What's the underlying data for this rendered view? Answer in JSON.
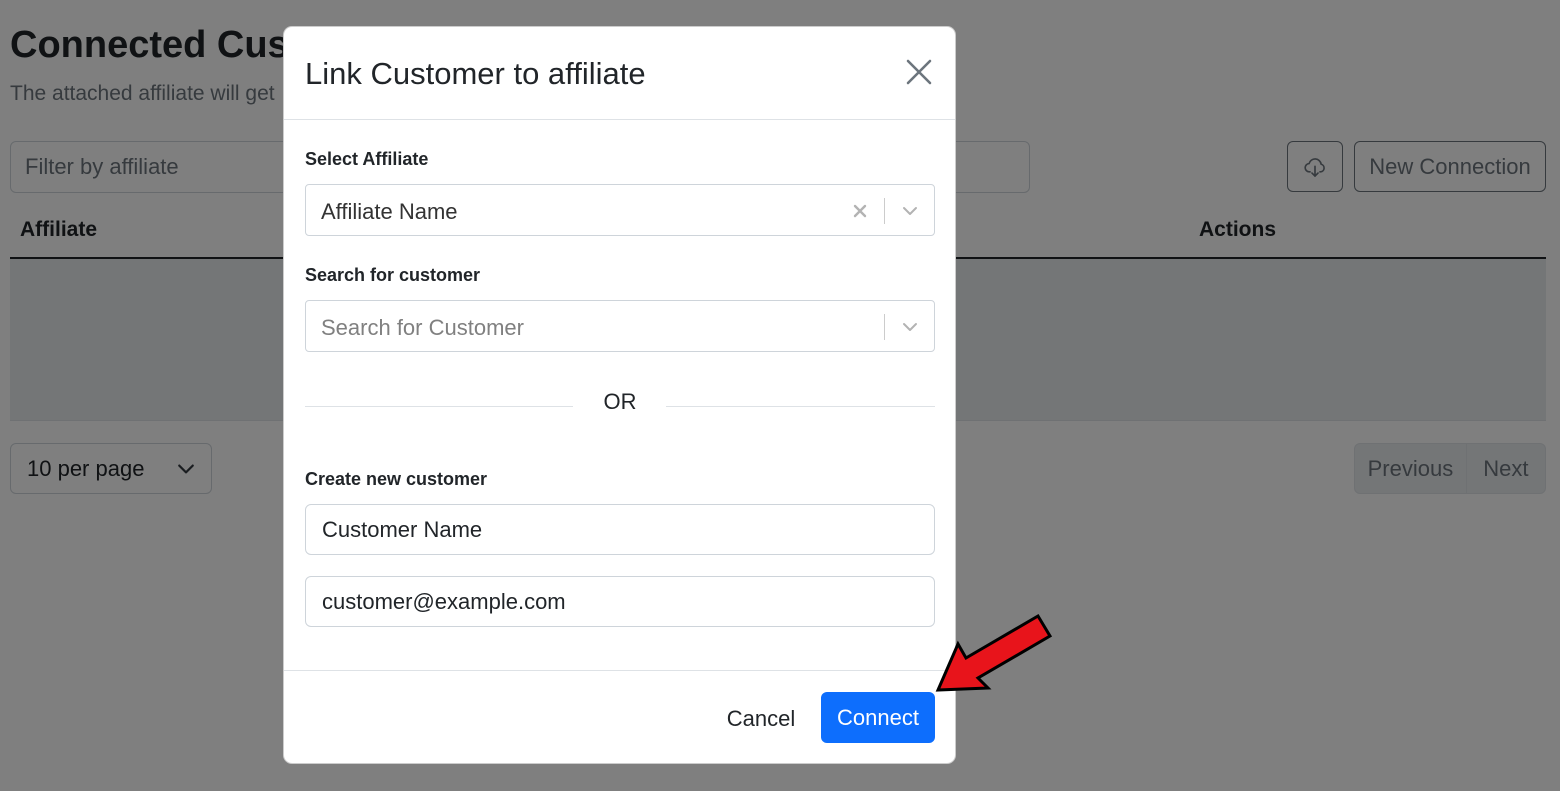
{
  "page": {
    "title": "Connected Customers",
    "subtitle": "The attached affiliate will get",
    "filter_placeholder": "Filter by affiliate",
    "download_icon": "cloud-download-icon",
    "new_connection_label": "New Connection",
    "table": {
      "columns": [
        "Affiliate",
        "Actions"
      ]
    },
    "per_page_label": "10 per page",
    "pagination": {
      "previous_label": "Previous",
      "next_label": "Next"
    }
  },
  "modal": {
    "title": "Link Customer to affiliate",
    "close_icon": "close-icon",
    "select_affiliate": {
      "label": "Select Affiliate",
      "value": "Affiliate Name"
    },
    "search_customer": {
      "label": "Search for customer",
      "placeholder": "Search for Customer"
    },
    "or_label": "OR",
    "create_customer": {
      "label": "Create new customer",
      "name_value": "Customer Name",
      "email_value": "customer@example.com"
    },
    "footer": {
      "cancel_label": "Cancel",
      "connect_label": "Connect"
    }
  },
  "colors": {
    "primary": "#0d6efd",
    "annotation_arrow": "#e8141b",
    "backdrop": "rgba(0,0,0,0.5)"
  }
}
